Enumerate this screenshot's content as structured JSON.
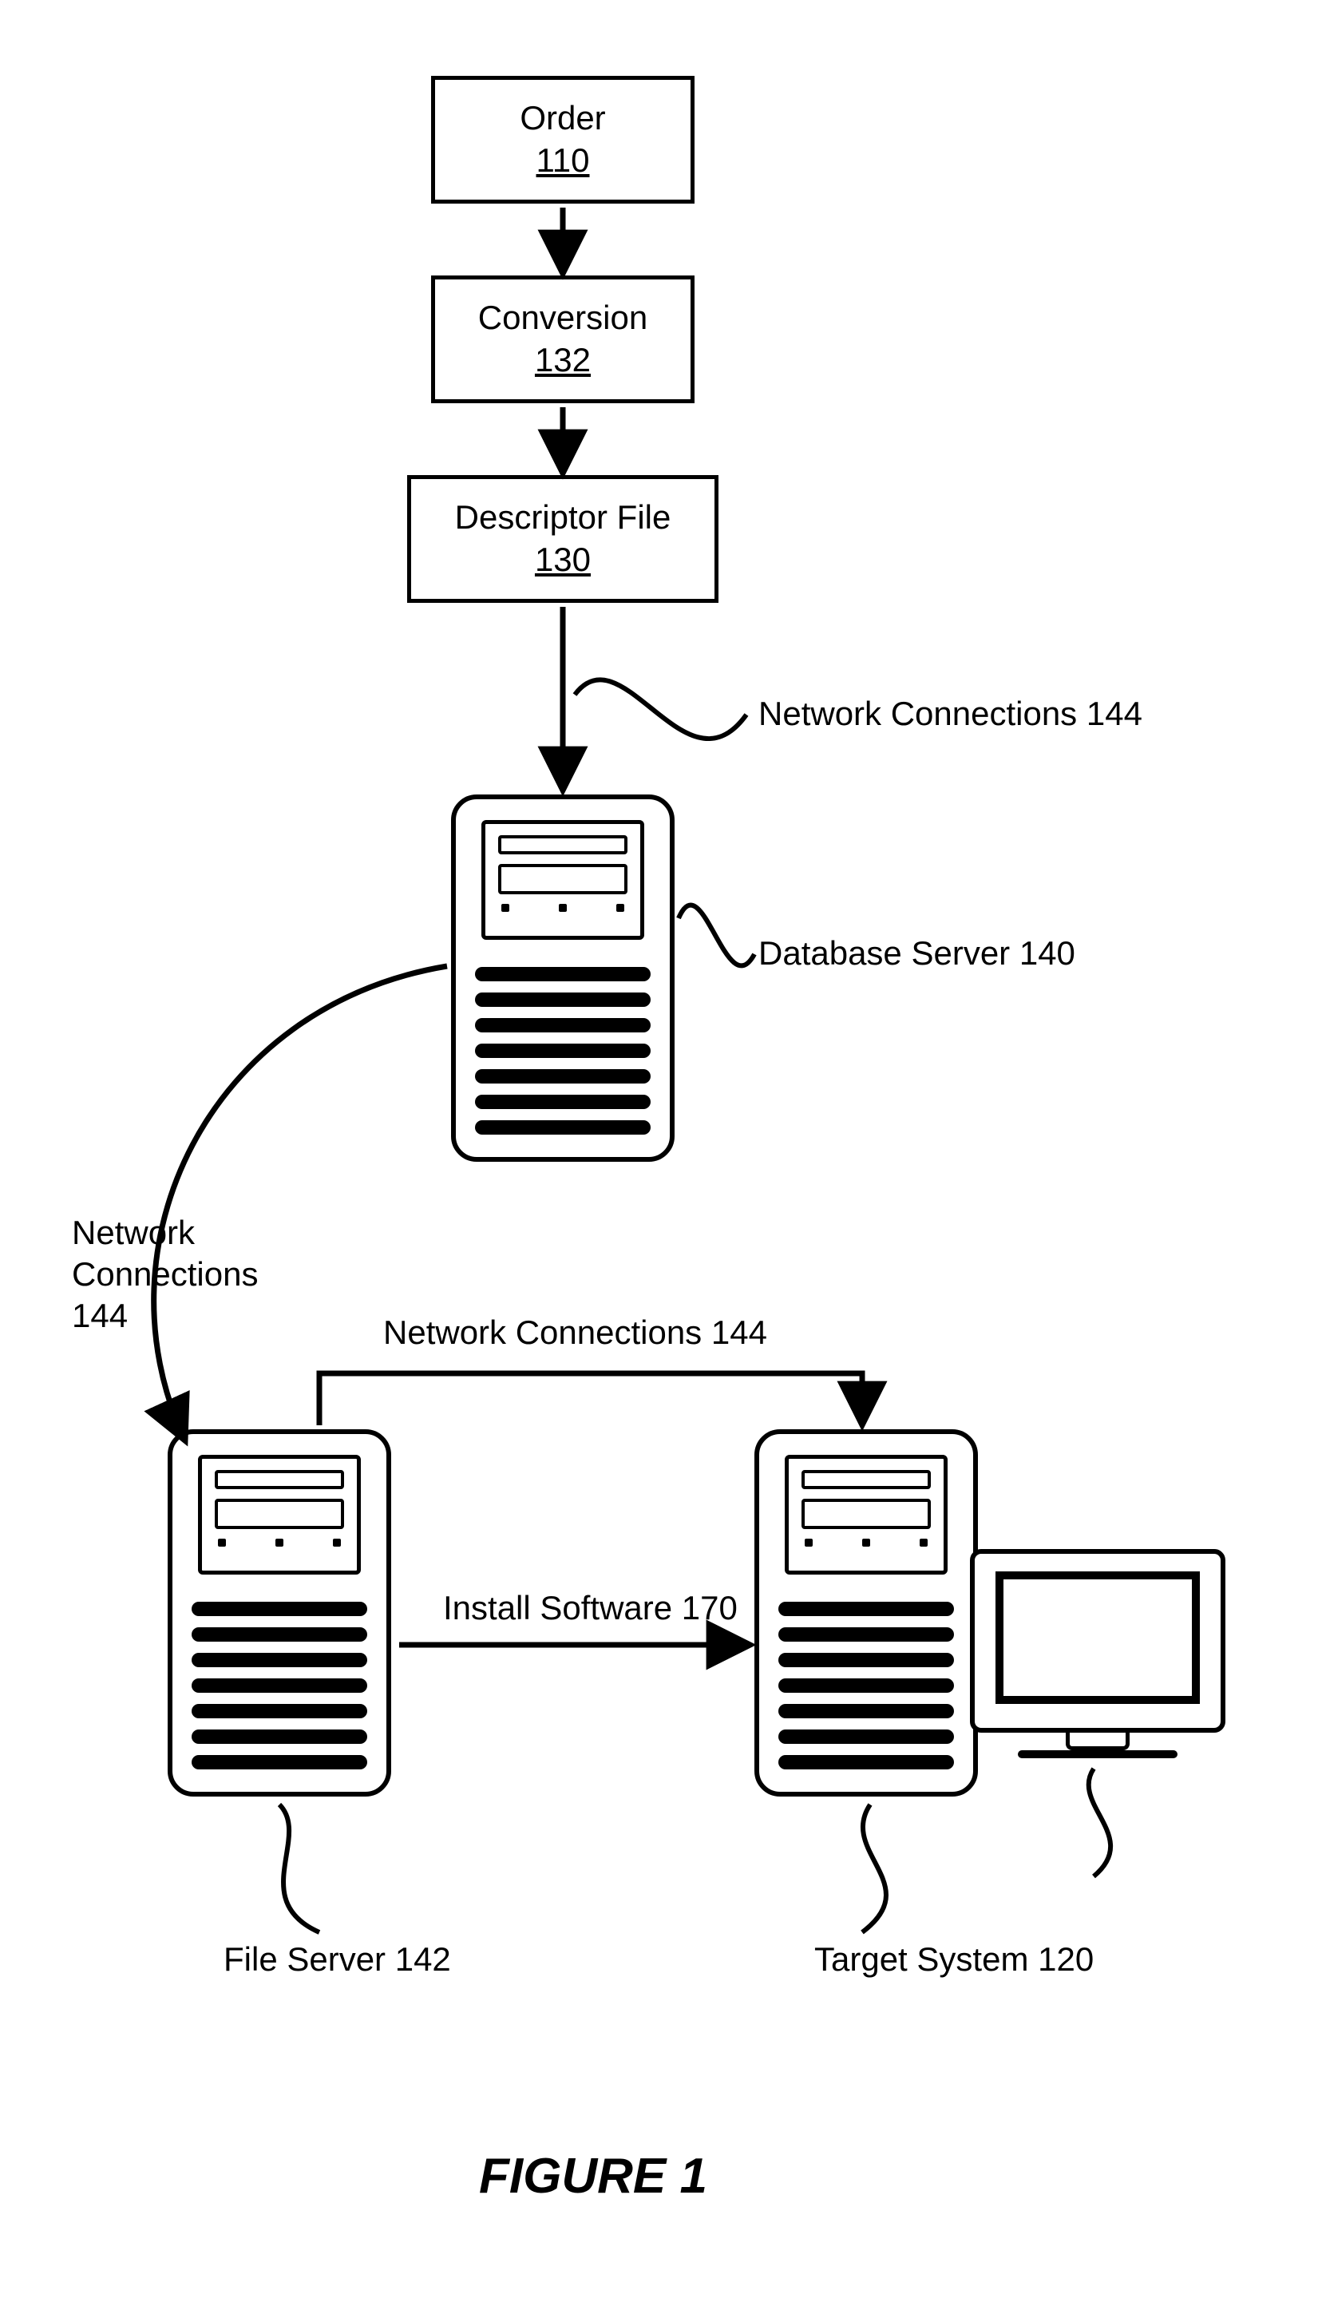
{
  "boxes": {
    "order": {
      "label": "Order",
      "ref": "110"
    },
    "conversion": {
      "label": "Conversion",
      "ref": "132"
    },
    "descriptor": {
      "label": "Descriptor File",
      "ref": "130"
    }
  },
  "labels": {
    "netconn_top": "Network Connections 144",
    "dbserver": "Database Server 140",
    "netconn_left_l1": "Network",
    "netconn_left_l2": "Connections",
    "netconn_left_l3": "144",
    "netconn_mid": "Network Connections 144",
    "install": "Install Software 170",
    "fileserver": "File Server 142",
    "target": "Target System 120"
  },
  "figure_caption": "FIGURE 1"
}
